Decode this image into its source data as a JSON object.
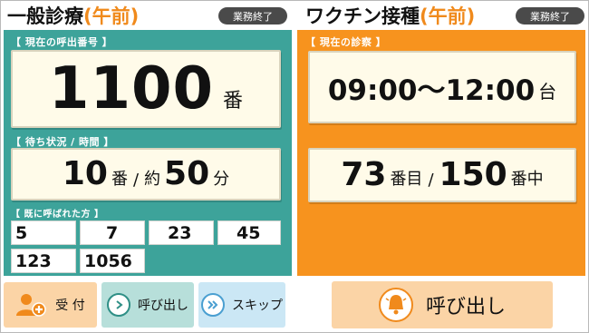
{
  "left": {
    "title": "一般診療",
    "title_sub": "(午前)",
    "status": "業務終了",
    "current_label": "【 現在の呼出番号 】",
    "current_number": "1100",
    "current_unit": "番",
    "wait_label": "【 待ち状況 / 時間 】",
    "wait_count": "10",
    "wait_count_unit": "番",
    "wait_sep": "/",
    "wait_approx": "約",
    "wait_time": "50",
    "wait_time_unit": "分",
    "called_label": "【 既に呼ばれた方 】",
    "called_numbers": [
      "5",
      "7",
      "23",
      "45",
      "123",
      "1056"
    ]
  },
  "right": {
    "title": "ワクチン接種",
    "title_sub": "(午前)",
    "status": "業務終了",
    "current_label": "【 現在の診察 】",
    "time_range": "09:00～12:00",
    "time_unit": "台",
    "order": "73",
    "order_unit": "番目",
    "order_sep": "/",
    "total": "150",
    "total_unit": "番中"
  },
  "buttons": {
    "reception": "受 付",
    "call": "呼び出し",
    "skip": "スキップ",
    "call_big": "呼び出し"
  },
  "colors": {
    "teal": "#3da39a",
    "orange": "#f7931e",
    "accent_orange": "#f08a1c"
  }
}
